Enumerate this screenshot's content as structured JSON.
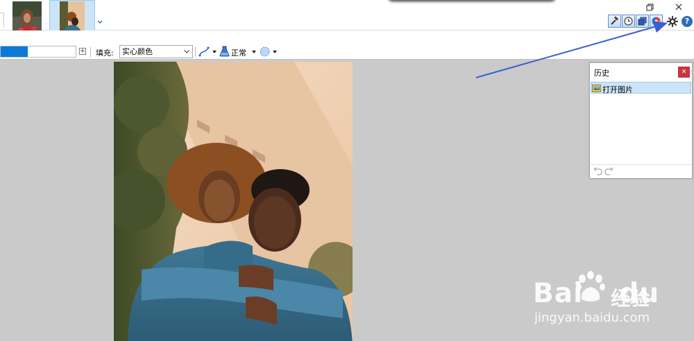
{
  "window": {
    "restore_glyph": "❐",
    "close_glyph": "✕"
  },
  "toolbar": {
    "tool_buttons": [
      "hammer-icon",
      "clock-icon",
      "layers-icon",
      "color-wheel-icon"
    ],
    "help_glyph": "?",
    "brush_width_fraction": 0.36,
    "width_plus": "+",
    "fill_label": "填充:",
    "fill_value": "实心颜色",
    "blend_label": "正常"
  },
  "history": {
    "title": "历史",
    "close_glyph": "✕",
    "items": [
      {
        "label": "打开图片",
        "icon": "open-image-icon"
      }
    ]
  },
  "watermark": {
    "brand": "Bai",
    "brand2": "du",
    "brand_cn": "经验",
    "url": "jingyan.baidu.com"
  },
  "colors": {
    "accent_blue": "#0c79d6",
    "selection_bg": "#cce4f7",
    "close_red": "#c8373e",
    "annotation_arrow": "#3b5fd1",
    "workspace_gray": "#cacaca"
  }
}
